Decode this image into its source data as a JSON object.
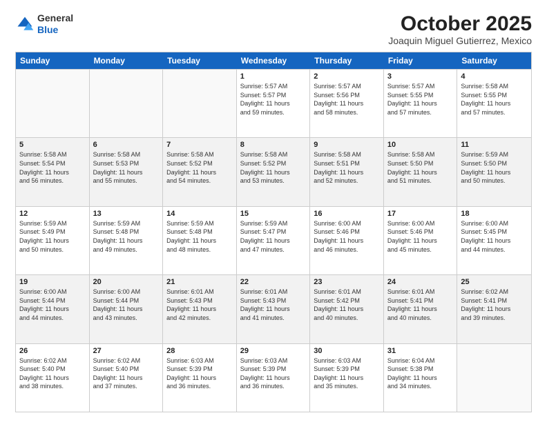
{
  "logo": {
    "general": "General",
    "blue": "Blue"
  },
  "title": "October 2025",
  "location": "Joaquin Miguel Gutierrez, Mexico",
  "days_of_week": [
    "Sunday",
    "Monday",
    "Tuesday",
    "Wednesday",
    "Thursday",
    "Friday",
    "Saturday"
  ],
  "weeks": [
    {
      "shaded": false,
      "cells": [
        {
          "day": "",
          "info": ""
        },
        {
          "day": "",
          "info": ""
        },
        {
          "day": "",
          "info": ""
        },
        {
          "day": "1",
          "info": "Sunrise: 5:57 AM\nSunset: 5:57 PM\nDaylight: 11 hours\nand 59 minutes."
        },
        {
          "day": "2",
          "info": "Sunrise: 5:57 AM\nSunset: 5:56 PM\nDaylight: 11 hours\nand 58 minutes."
        },
        {
          "day": "3",
          "info": "Sunrise: 5:57 AM\nSunset: 5:55 PM\nDaylight: 11 hours\nand 57 minutes."
        },
        {
          "day": "4",
          "info": "Sunrise: 5:58 AM\nSunset: 5:55 PM\nDaylight: 11 hours\nand 57 minutes."
        }
      ]
    },
    {
      "shaded": true,
      "cells": [
        {
          "day": "5",
          "info": "Sunrise: 5:58 AM\nSunset: 5:54 PM\nDaylight: 11 hours\nand 56 minutes."
        },
        {
          "day": "6",
          "info": "Sunrise: 5:58 AM\nSunset: 5:53 PM\nDaylight: 11 hours\nand 55 minutes."
        },
        {
          "day": "7",
          "info": "Sunrise: 5:58 AM\nSunset: 5:52 PM\nDaylight: 11 hours\nand 54 minutes."
        },
        {
          "day": "8",
          "info": "Sunrise: 5:58 AM\nSunset: 5:52 PM\nDaylight: 11 hours\nand 53 minutes."
        },
        {
          "day": "9",
          "info": "Sunrise: 5:58 AM\nSunset: 5:51 PM\nDaylight: 11 hours\nand 52 minutes."
        },
        {
          "day": "10",
          "info": "Sunrise: 5:58 AM\nSunset: 5:50 PM\nDaylight: 11 hours\nand 51 minutes."
        },
        {
          "day": "11",
          "info": "Sunrise: 5:59 AM\nSunset: 5:50 PM\nDaylight: 11 hours\nand 50 minutes."
        }
      ]
    },
    {
      "shaded": false,
      "cells": [
        {
          "day": "12",
          "info": "Sunrise: 5:59 AM\nSunset: 5:49 PM\nDaylight: 11 hours\nand 50 minutes."
        },
        {
          "day": "13",
          "info": "Sunrise: 5:59 AM\nSunset: 5:48 PM\nDaylight: 11 hours\nand 49 minutes."
        },
        {
          "day": "14",
          "info": "Sunrise: 5:59 AM\nSunset: 5:48 PM\nDaylight: 11 hours\nand 48 minutes."
        },
        {
          "day": "15",
          "info": "Sunrise: 5:59 AM\nSunset: 5:47 PM\nDaylight: 11 hours\nand 47 minutes."
        },
        {
          "day": "16",
          "info": "Sunrise: 6:00 AM\nSunset: 5:46 PM\nDaylight: 11 hours\nand 46 minutes."
        },
        {
          "day": "17",
          "info": "Sunrise: 6:00 AM\nSunset: 5:46 PM\nDaylight: 11 hours\nand 45 minutes."
        },
        {
          "day": "18",
          "info": "Sunrise: 6:00 AM\nSunset: 5:45 PM\nDaylight: 11 hours\nand 44 minutes."
        }
      ]
    },
    {
      "shaded": true,
      "cells": [
        {
          "day": "19",
          "info": "Sunrise: 6:00 AM\nSunset: 5:44 PM\nDaylight: 11 hours\nand 44 minutes."
        },
        {
          "day": "20",
          "info": "Sunrise: 6:00 AM\nSunset: 5:44 PM\nDaylight: 11 hours\nand 43 minutes."
        },
        {
          "day": "21",
          "info": "Sunrise: 6:01 AM\nSunset: 5:43 PM\nDaylight: 11 hours\nand 42 minutes."
        },
        {
          "day": "22",
          "info": "Sunrise: 6:01 AM\nSunset: 5:43 PM\nDaylight: 11 hours\nand 41 minutes."
        },
        {
          "day": "23",
          "info": "Sunrise: 6:01 AM\nSunset: 5:42 PM\nDaylight: 11 hours\nand 40 minutes."
        },
        {
          "day": "24",
          "info": "Sunrise: 6:01 AM\nSunset: 5:41 PM\nDaylight: 11 hours\nand 40 minutes."
        },
        {
          "day": "25",
          "info": "Sunrise: 6:02 AM\nSunset: 5:41 PM\nDaylight: 11 hours\nand 39 minutes."
        }
      ]
    },
    {
      "shaded": false,
      "cells": [
        {
          "day": "26",
          "info": "Sunrise: 6:02 AM\nSunset: 5:40 PM\nDaylight: 11 hours\nand 38 minutes."
        },
        {
          "day": "27",
          "info": "Sunrise: 6:02 AM\nSunset: 5:40 PM\nDaylight: 11 hours\nand 37 minutes."
        },
        {
          "day": "28",
          "info": "Sunrise: 6:03 AM\nSunset: 5:39 PM\nDaylight: 11 hours\nand 36 minutes."
        },
        {
          "day": "29",
          "info": "Sunrise: 6:03 AM\nSunset: 5:39 PM\nDaylight: 11 hours\nand 36 minutes."
        },
        {
          "day": "30",
          "info": "Sunrise: 6:03 AM\nSunset: 5:39 PM\nDaylight: 11 hours\nand 35 minutes."
        },
        {
          "day": "31",
          "info": "Sunrise: 6:04 AM\nSunset: 5:38 PM\nDaylight: 11 hours\nand 34 minutes."
        },
        {
          "day": "",
          "info": ""
        }
      ]
    }
  ]
}
